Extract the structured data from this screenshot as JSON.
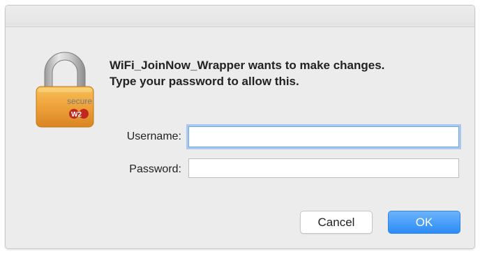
{
  "dialog": {
    "message_line1": "WiFi_JoinNow_Wrapper wants to make changes.",
    "message_line2": "Type your password to allow this.",
    "icon": "secure-w2-lock-icon",
    "icon_text": "secure",
    "icon_badge": "W2"
  },
  "form": {
    "username_label": "Username:",
    "username_value": "",
    "password_label": "Password:",
    "password_value": ""
  },
  "buttons": {
    "cancel_label": "Cancel",
    "ok_label": "OK"
  },
  "colors": {
    "dialog_background": "#ececec",
    "lock_body": "#f0a43c",
    "lock_shackle": "#b8b8b8",
    "badge_red": "#c0281e",
    "ok_button": "#2d8cf6",
    "focus_ring": "#a9c9f0"
  }
}
